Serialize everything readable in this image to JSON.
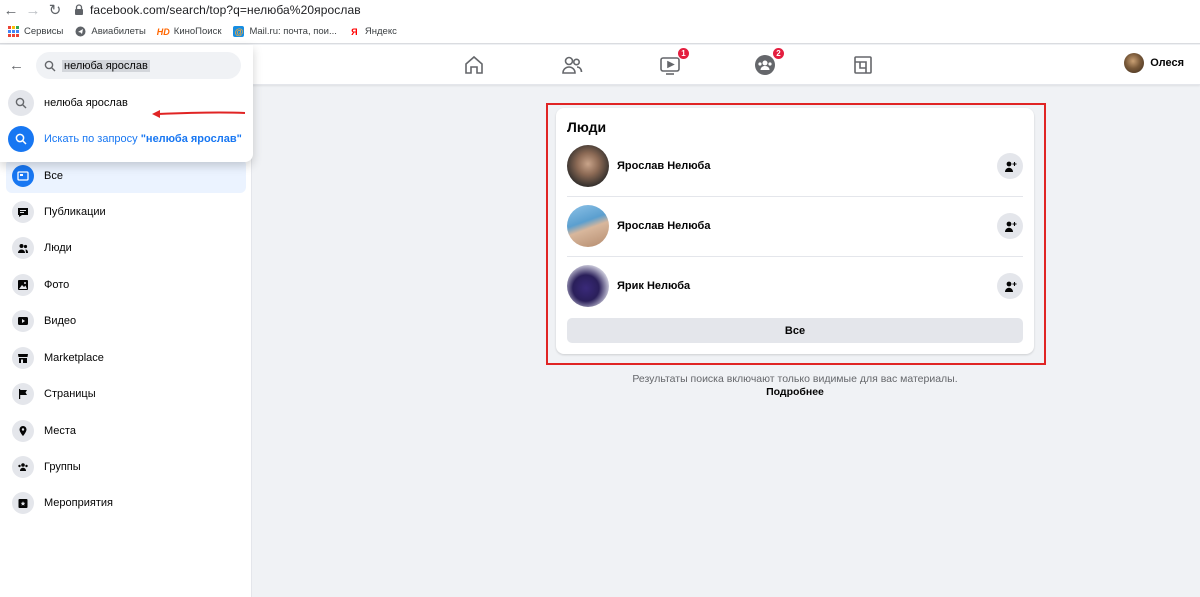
{
  "browser": {
    "url": "facebook.com/search/top?q=нелюба%20ярослав",
    "bookmarks": [
      {
        "label": "Сервисы",
        "icon": "apps-grid-icon"
      },
      {
        "label": "Авиабилеты",
        "icon": "plane-icon"
      },
      {
        "label": "КиноПоиск",
        "icon": "kinopoisk-icon"
      },
      {
        "label": "Mail.ru: почта, пои...",
        "icon": "mailru-icon"
      },
      {
        "label": "Яндекс",
        "icon": "yandex-icon"
      }
    ]
  },
  "topbar": {
    "watch_badge": "1",
    "groups_badge": "2",
    "profile_name": "Олеся"
  },
  "search": {
    "query": "нелюба ярослав",
    "suggestion": "нелюба ярослав",
    "search_for_prefix": "Искать по запросу ",
    "search_for_query": "\"нелюба ярослав\""
  },
  "sidebar": {
    "items": [
      {
        "label": "Все",
        "icon": "all-results-icon"
      },
      {
        "label": "Публикации",
        "icon": "posts-icon"
      },
      {
        "label": "Люди",
        "icon": "people-icon"
      },
      {
        "label": "Фото",
        "icon": "photo-icon"
      },
      {
        "label": "Видео",
        "icon": "video-icon"
      },
      {
        "label": "Marketplace",
        "icon": "marketplace-icon"
      },
      {
        "label": "Страницы",
        "icon": "pages-flag-icon"
      },
      {
        "label": "Места",
        "icon": "location-pin-icon"
      },
      {
        "label": "Группы",
        "icon": "groups-icon"
      },
      {
        "label": "Мероприятия",
        "icon": "events-icon"
      }
    ]
  },
  "results": {
    "section_title": "Люди",
    "people": [
      {
        "name": "Ярослав Нелюба"
      },
      {
        "name": "Ярослав Нелюба"
      },
      {
        "name": "Ярик Нелюба"
      }
    ],
    "all_button": "Все",
    "note": "Результаты поиска включают только видимые для вас материалы.",
    "more_link": "Подробнее"
  },
  "colors": {
    "accent": "#1877f2",
    "highlight_box": "#e02424",
    "badge": "#e41e3f"
  }
}
